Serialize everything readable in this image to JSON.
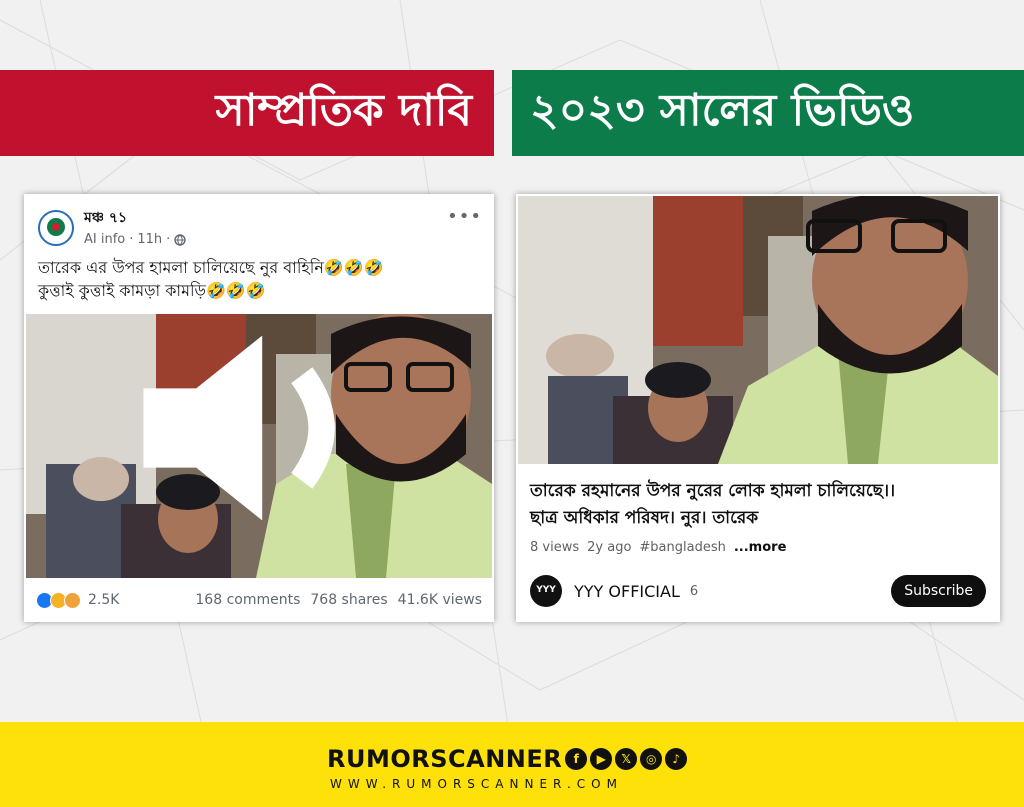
{
  "banners": {
    "left_label": "সাম্প্রতিক দাবি",
    "right_label": "২০২৩ সালের ভিডিও",
    "left_color": "#c0122f",
    "right_color": "#0c7d4a"
  },
  "facebook_post": {
    "page_name": "মঞ্চ ৭১",
    "meta_source": "AI info",
    "meta_time": "11h",
    "caption_line1": "তারেক এর উপর হামলা চালিয়েছে নুর বাহিনি🤣🤣🤣",
    "caption_line2": "কুত্তাই কুত্তাই কামড়া কামড়ি🤣🤣🤣",
    "reaction_count": "2.5K",
    "comments": "168 comments",
    "shares": "768 shares",
    "views": "41.6K views",
    "more_icon": "more-horizontal-icon",
    "sound_icon": "speaker-icon",
    "privacy_icon": "globe-icon"
  },
  "youtube_video": {
    "title_line1": "তারেক রহমানের উপর নুরের লোক হামলা চালিয়েছে।।",
    "title_line2": "ছাত্র অধিকার পরিষদ। নুর। তারেক",
    "views": "8 views",
    "age": "2y ago",
    "hashtag": "#bangladesh",
    "more": "...more",
    "channel_logo_text": "YYY",
    "channel_name": "YYY OFFICIAL",
    "subscriber_count": "6",
    "subscribe_label": "Subscribe"
  },
  "footer": {
    "brand": "RUMORSCANNER",
    "website": "WWW.RUMORSCANNER.COM",
    "social_icons": [
      "facebook-icon",
      "youtube-icon",
      "x-icon",
      "instagram-icon",
      "tiktok-icon"
    ],
    "social_glyphs": [
      "f",
      "▶",
      "𝕏",
      "◎",
      "♪"
    ],
    "background_color": "#ffe10a"
  }
}
